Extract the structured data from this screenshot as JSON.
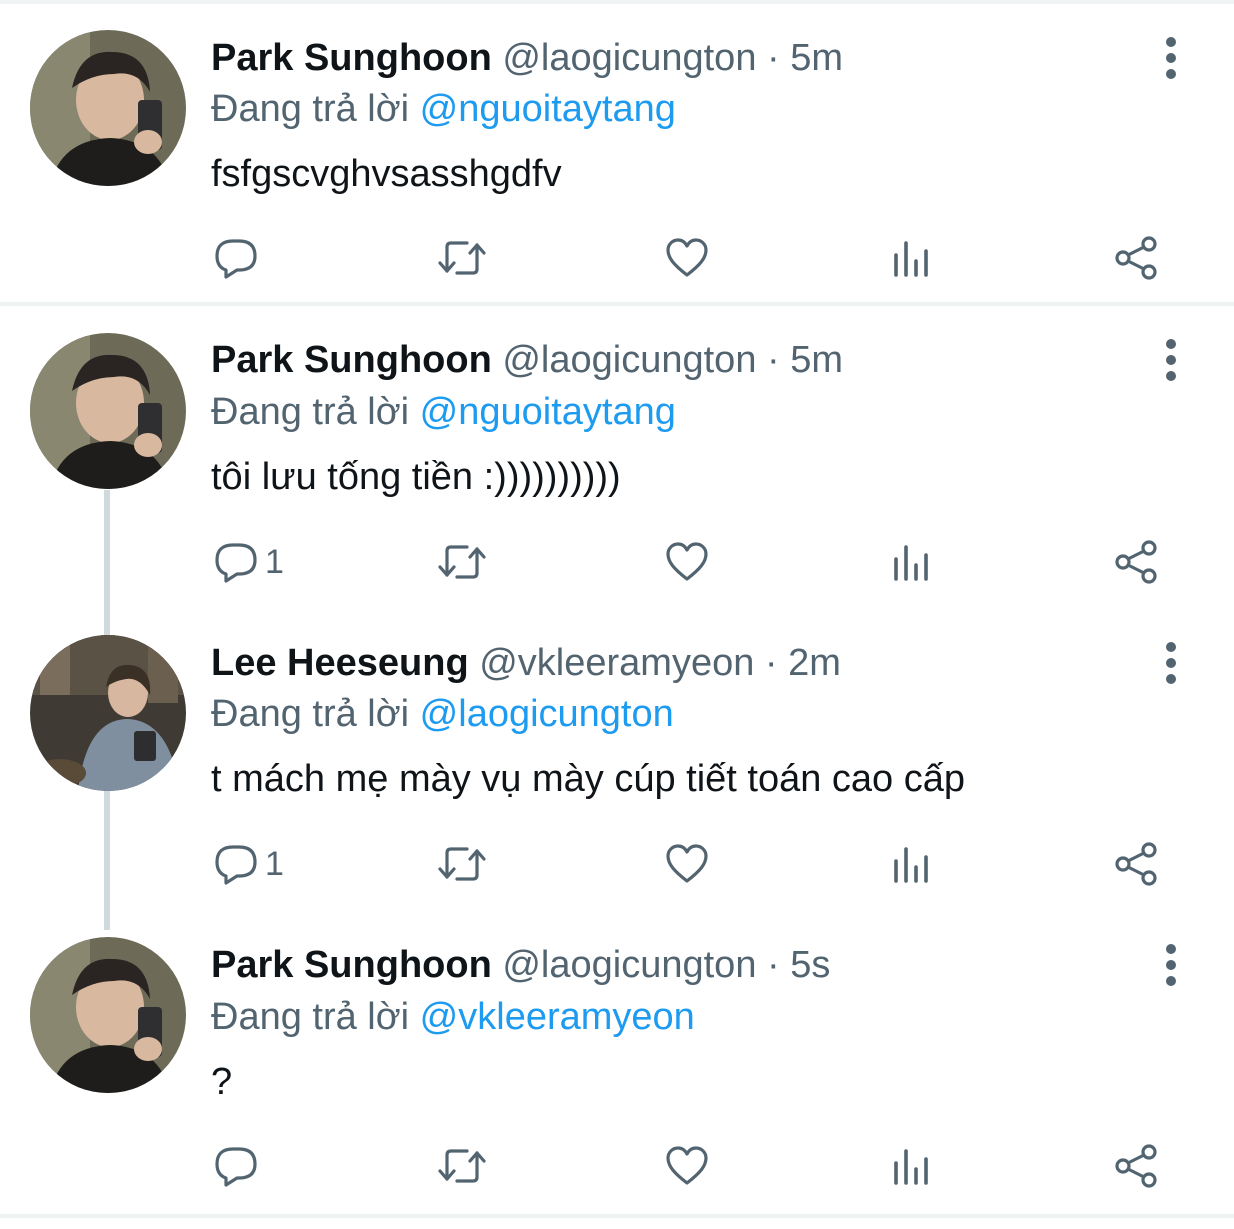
{
  "tweets": [
    {
      "name": "Park Sunghoon",
      "handle": "@laogicungton",
      "dot": "·",
      "time": "5m",
      "reply_prefix": "Đang trả lời",
      "reply_to": "@nguoitaytang",
      "text": "fsfgscvghvsasshgdfv",
      "reply_count": ""
    },
    {
      "name": "Park Sunghoon",
      "handle": "@laogicungton",
      "dot": "·",
      "time": "5m",
      "reply_prefix": "Đang trả lời",
      "reply_to": "@nguoitaytang",
      "text": "tôi lưu tống tiền :))))))))))",
      "reply_count": "1"
    },
    {
      "name": "Lee Heeseung",
      "handle": "@vkleeramyeon",
      "dot": "·",
      "time": "2m",
      "reply_prefix": "Đang trả lời",
      "reply_to": "@laogicungton",
      "text": "t mách mẹ mày vụ mày cúp tiết toán cao cấp",
      "reply_count": "1"
    },
    {
      "name": "Park Sunghoon",
      "handle": "@laogicungton",
      "dot": "·",
      "time": "5s",
      "reply_prefix": "Đang trả lời",
      "reply_to": "@vkleeramyeon",
      "text": "?",
      "reply_count": ""
    }
  ],
  "icons": {
    "reply": "speech-bubble-icon",
    "retweet": "retweet-arrows-icon",
    "like": "heart-icon",
    "views": "bar-chart-icon",
    "share": "share-nodes-icon",
    "more": "vertical-dots-icon"
  },
  "colors": {
    "accent": "#1d9bf0",
    "secondary_text": "#536471",
    "primary_text": "#0f1419",
    "thread_line": "#cfd9de",
    "divider": "#eff3f4"
  }
}
